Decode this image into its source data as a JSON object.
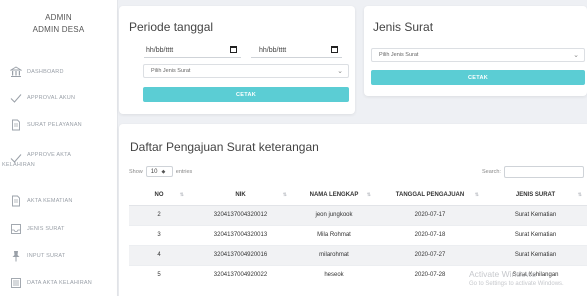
{
  "sidebar": {
    "user": {
      "line1": "ADMIN",
      "line2": "ADMIN DESA"
    },
    "items": [
      {
        "label": "DASHBOARD",
        "icon": "bank-icon"
      },
      {
        "label": "APPROVAL AKUN",
        "icon": "check-icon"
      },
      {
        "label": "SURAT PELAYANAN",
        "icon": "document-icon"
      },
      {
        "label_line1": "APPROVE AKTA",
        "label_line2": "KELAHIRAN",
        "icon": "check-icon"
      },
      {
        "label": "AKTA KEMATIAN",
        "icon": "document-icon"
      },
      {
        "label": "JENIS SURAT",
        "icon": "inbox-icon"
      },
      {
        "label": "INPUT SURAT",
        "icon": "pin-icon"
      },
      {
        "label": "DATA AKTA KELAHIRAN",
        "icon": "list-icon"
      }
    ]
  },
  "periode": {
    "title": "Periode tanggal",
    "date_start_placeholder": "hh/bb/tttt",
    "date_end_placeholder": "hh/bb/tttt",
    "select_value": "Pilih Jenis Surat",
    "button": "CETAK"
  },
  "jenis": {
    "title": "Jenis Surat",
    "select_value": "Pilih Jenis Surat",
    "button": "CETAK"
  },
  "table": {
    "title": "Daftar Pengajuan Surat keterangan",
    "show_label": "Show",
    "entries_value": "10",
    "entries_label": "entries",
    "search_label": "Search:",
    "headers": [
      "NO",
      "NIK",
      "NAMA LENGKAP",
      "TANGGAL PENGAJUAN",
      "JENIS SURAT"
    ],
    "rows": [
      [
        "2",
        "3204137004320012",
        "jeon jungkook",
        "2020-07-17",
        "Surat Kematian"
      ],
      [
        "3",
        "3204137004320013",
        "Mila Rohmat",
        "2020-07-18",
        "Surat Kematian"
      ],
      [
        "4",
        "3204137004920016",
        "milarohmat",
        "2020-07-27",
        "Surat Kematian"
      ],
      [
        "5",
        "3204137004920022",
        "heseok",
        "2020-07-28",
        "Surat Kehilangan"
      ]
    ]
  },
  "watermark": {
    "line1": "Activate Windows",
    "line2": "Go to Settings to activate Windows."
  },
  "colors": {
    "accent": "#5bcdd4",
    "background": "#eef0f4",
    "sidebar_text": "#9aa0a8"
  }
}
